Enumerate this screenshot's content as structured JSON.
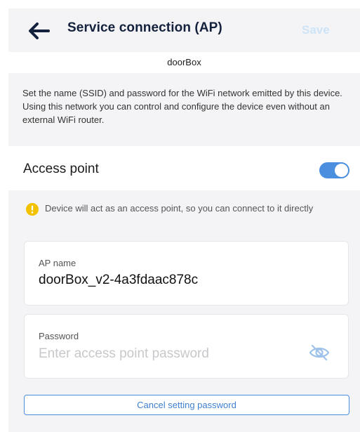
{
  "header": {
    "back_icon": "arrow-left-icon",
    "title": "Service connection (AP)",
    "save_label": "Save"
  },
  "device": {
    "name": "doorBox"
  },
  "description": "Set the name (SSID) and password for the WiFi network emitted by this device. Using this network you can control and configure the device even without an external WiFi router.",
  "access_point": {
    "label": "Access point",
    "enabled": true
  },
  "info": {
    "icon": "warning-icon",
    "text": "Device will act as an access point, so you can connect to it directly"
  },
  "ap_name": {
    "label": "AP name",
    "value": "doorBox_v2-4a3fdaac878c"
  },
  "password": {
    "label": "Password",
    "value": "",
    "placeholder": "Enter access point password",
    "visibility_icon": "eye-off-icon"
  },
  "cancel_button": {
    "label": "Cancel setting password"
  },
  "colors": {
    "accent": "#4a8ee0",
    "title": "#14213d",
    "save_disabled": "#cde3f7",
    "warning": "#f2c200",
    "section_bg": "#f4f4f6"
  }
}
